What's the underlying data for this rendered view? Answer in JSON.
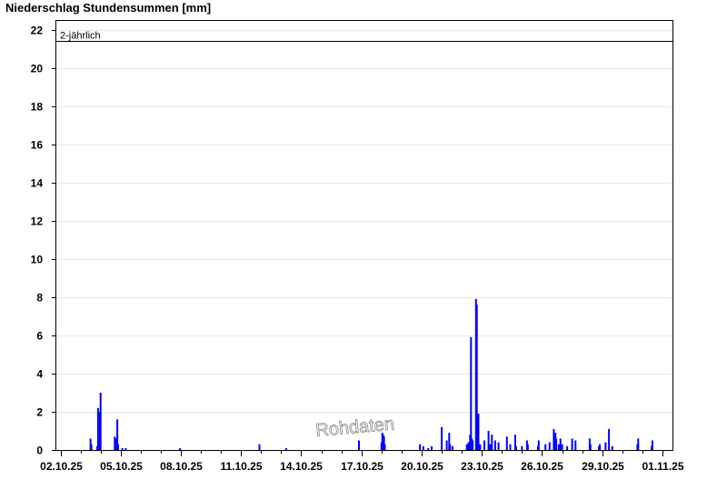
{
  "chart_data": {
    "type": "bar",
    "title": "Niederschlag Stundensummen [mm]",
    "xlabel": "",
    "ylabel": "",
    "ylim": [
      0,
      22.5
    ],
    "yticks": [
      0,
      2,
      4,
      6,
      8,
      10,
      12,
      14,
      16,
      18,
      20,
      22
    ],
    "xlim": [
      "2025-10-01T18:00",
      "2025-11-01T12:00"
    ],
    "xticks": [
      "2025-10-02",
      "2025-10-05",
      "2025-10-08",
      "2025-10-11",
      "2025-10-14",
      "2025-10-17",
      "2025-10-20",
      "2025-10-23",
      "2025-10-26",
      "2025-10-29",
      "2025-11-01"
    ],
    "xtick_labels": [
      "02.10.25",
      "05.10.25",
      "08.10.25",
      "11.10.25",
      "14.10.25",
      "17.10.25",
      "20.10.25",
      "23.10.25",
      "26.10.25",
      "29.10.25",
      "01.11.25"
    ],
    "grid": true,
    "bar_color": "#0000ff",
    "reference_line": {
      "label": "2-jährlich",
      "value": 21.4
    },
    "watermark": "Rohdaten",
    "series": [
      {
        "x": [
          "2025-10-03T12:00",
          "2025-10-03T13:00",
          "2025-10-03T20:00",
          "2025-10-03T21:00",
          "2025-10-03T23:00",
          "2025-10-04T00:00",
          "2025-10-04T17:00",
          "2025-10-04T18:00",
          "2025-10-04T20:00",
          "2025-10-04T21:00",
          "2025-10-05T02:00",
          "2025-10-05T06:00",
          "2025-10-07T23:00",
          "2025-10-11T22:00",
          "2025-10-13T06:00",
          "2025-10-16T21:00",
          "2025-10-18T00:00",
          "2025-10-18T01:00",
          "2025-10-18T02:00",
          "2025-10-18T03:00",
          "2025-10-18T04:00",
          "2025-10-19T22:00",
          "2025-10-20T02:00",
          "2025-10-20T08:00",
          "2025-10-20T12:00",
          "2025-10-21T00:00",
          "2025-10-21T06:00",
          "2025-10-21T09:00",
          "2025-10-21T10:00",
          "2025-10-21T13:00",
          "2025-10-22T06:00",
          "2025-10-22T08:00",
          "2025-10-22T10:00",
          "2025-10-22T11:00",
          "2025-10-22T12:00",
          "2025-10-22T13:00",
          "2025-10-22T17:00",
          "2025-10-22T18:00",
          "2025-10-22T20:00",
          "2025-10-22T22:00",
          "2025-10-23T03:00",
          "2025-10-23T08:00",
          "2025-10-23T10:00",
          "2025-10-23T12:00",
          "2025-10-23T16:00",
          "2025-10-23T20:00",
          "2025-10-24T06:00",
          "2025-10-24T10:00",
          "2025-10-24T16:00",
          "2025-10-24T17:00",
          "2025-10-25T00:00",
          "2025-10-25T06:00",
          "2025-10-25T07:00",
          "2025-10-25T19:00",
          "2025-10-25T20:00",
          "2025-10-26T04:00",
          "2025-10-26T09:00",
          "2025-10-26T14:00",
          "2025-10-26T15:00",
          "2025-10-26T16:00",
          "2025-10-26T17:00",
          "2025-10-26T20:00",
          "2025-10-26T22:00",
          "2025-10-27T00:00",
          "2025-10-27T06:00",
          "2025-10-27T12:00",
          "2025-10-27T16:00",
          "2025-10-28T09:00",
          "2025-10-28T10:00",
          "2025-10-28T20:00",
          "2025-10-28T21:00",
          "2025-10-29T04:00",
          "2025-10-29T08:00",
          "2025-10-29T12:00",
          "2025-10-30T18:00",
          "2025-10-30T19:00",
          "2025-10-31T11:00",
          "2025-10-31T12:00"
        ],
        "values": [
          0.6,
          0.3,
          0.2,
          2.2,
          2.0,
          3.0,
          0.7,
          0.6,
          1.6,
          0.3,
          0.1,
          0.1,
          0.1,
          0.3,
          0.1,
          0.5,
          0.4,
          0.9,
          0.8,
          0.7,
          0.3,
          0.3,
          0.2,
          0.1,
          0.2,
          1.2,
          0.5,
          0.9,
          0.3,
          0.2,
          0.3,
          0.4,
          0.8,
          5.9,
          0.6,
          0.5,
          7.9,
          7.6,
          1.9,
          0.3,
          0.5,
          1.0,
          0.3,
          0.8,
          0.5,
          0.4,
          0.7,
          0.3,
          0.8,
          0.2,
          0.2,
          0.5,
          0.3,
          0.2,
          0.5,
          0.3,
          0.4,
          1.1,
          0.3,
          0.9,
          0.6,
          0.3,
          0.6,
          0.3,
          0.2,
          0.6,
          0.5,
          0.6,
          0.3,
          0.2,
          0.3,
          0.4,
          1.1,
          0.2,
          0.3,
          0.6,
          0.2,
          0.5
        ]
      }
    ]
  }
}
